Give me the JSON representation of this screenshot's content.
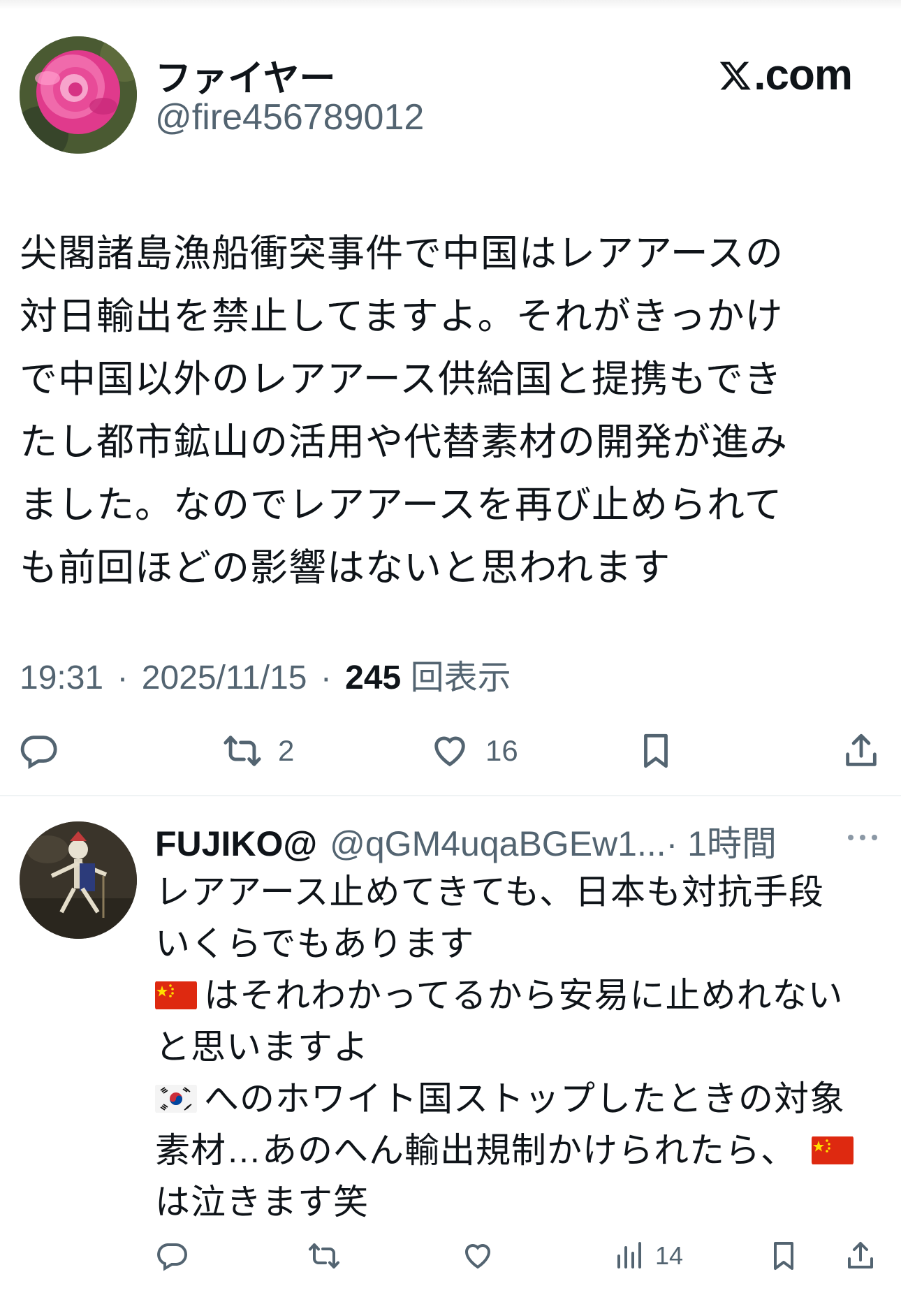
{
  "main_tweet": {
    "display_name": "ファイヤー",
    "handle": "@fire456789012",
    "brand": ".com",
    "text_lines": [
      "尖閣諸島漁船衝突事件で中国はレアアースの",
      "対日輸出を禁止してますよ。それがきっかけ",
      "で中国以外のレアアース供給国と提携もでき",
      "たし都市鉱山の活用や代替素材の開発が進み",
      "ました。なのでレアアースを再び止められて",
      "も前回ほどの影響はないと思われます"
    ],
    "time": "19:31",
    "date": "2025/11/15",
    "separator": "·",
    "views_count": "245",
    "views_label": "回表示",
    "actions": {
      "reply_icon": "reply-bubble-icon",
      "retweet_icon": "retweet-icon",
      "retweet_count": "2",
      "like_icon": "heart-icon",
      "like_count": "16",
      "bookmark_icon": "bookmark-icon",
      "share_icon": "share-icon"
    }
  },
  "reply": {
    "display_name": "FUJIKO@",
    "handle": "@qGM4uqaBGEw1...",
    "time": "· 1時間",
    "lines": {
      "l1": "レアアース止めてきても、日本も対抗手段",
      "l2": "いくらでもあります",
      "l3": "はそれわかってるから安易に止めれない",
      "l4": "と思いますよ",
      "l5": "へのホワイト国ストップしたときの対象",
      "l6": "素材…あのへん輸出規制かけられたら、",
      "l7": "は泣きます笑"
    },
    "flags": [
      "china-flag-icon",
      "korea-flag-icon"
    ],
    "actions": {
      "views_count": "14"
    }
  },
  "colors": {
    "text": "#0f1419",
    "secondary": "#536471",
    "divider": "#eff3f4"
  }
}
